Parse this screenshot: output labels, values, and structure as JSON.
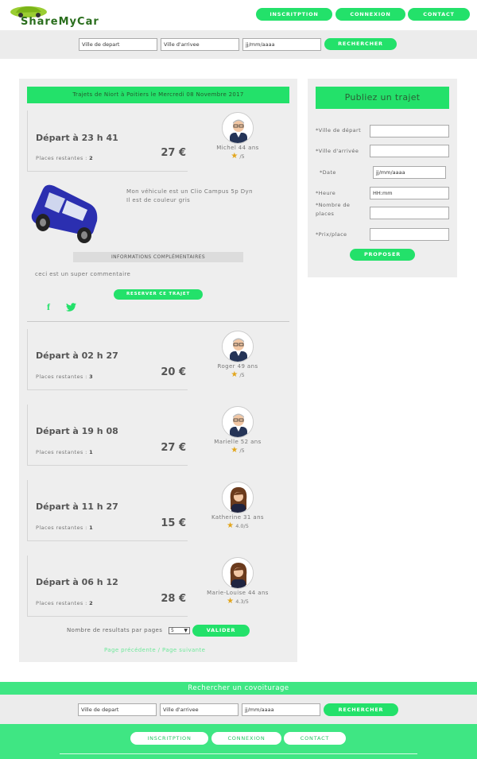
{
  "header": {
    "logo_text": "ShareMyCar",
    "nav": [
      "INSCRITPTION",
      "CONNEXION",
      "CONTACT"
    ]
  },
  "search": {
    "from_placeholder": "Ville de depart",
    "to_placeholder": "Ville d'arrivee",
    "date_placeholder": "jj/mm/aaaa",
    "button": "RECHERCHER"
  },
  "results": {
    "title": "Trajets de Niort à Poitiers le Mercredi 08 Novembre 2017",
    "places_label": "Places restantes :",
    "trips": [
      {
        "time": "Départ à 23 h 41",
        "places": "2",
        "price": "27 €",
        "driver": "Michel 44 ans",
        "rating": "/5",
        "avatar": "man"
      },
      {
        "time": "Départ à 02 h 27",
        "places": "3",
        "price": "20 €",
        "driver": "Roger 49 ans",
        "rating": "/5",
        "avatar": "man"
      },
      {
        "time": "Départ à 19 h 08",
        "places": "1",
        "price": "27 €",
        "driver": "Marielle 52 ans",
        "rating": "/5",
        "avatar": "man"
      },
      {
        "time": "Départ à 11 h 27",
        "places": "1",
        "price": "15 €",
        "driver": "Katherine 31 ans",
        "rating": "4.0/5",
        "avatar": "woman"
      },
      {
        "time": "Départ à 06 h 12",
        "places": "2",
        "price": "28 €",
        "driver": "Marie-Louise 44 ans",
        "rating": "4.3/5",
        "avatar": "woman"
      }
    ],
    "vehicle_line1": "Mon véhicule est un Clio Campus 5p Dyn",
    "vehicle_line2": "Il est de couleur gris",
    "info_header": "INFORMATIONS COMPLÉMENTAIRES",
    "comment": "ceci est un super commentaire",
    "reserve_button": "RESERVER CE TRAJET",
    "per_page_label": "Nombre de resultats par pages",
    "per_page_value": "5",
    "validate_button": "VALIDER",
    "pagination": "Page précédente / Page suivante"
  },
  "publish": {
    "title": "Publiez un trajet",
    "fields": [
      {
        "label": "*Ville de départ",
        "value": ""
      },
      {
        "label": "*Ville d'arrivée",
        "value": ""
      },
      {
        "label": "*Date",
        "value": "jj/mm/aaaa"
      },
      {
        "label": "*Heure",
        "value": "HH:mm"
      },
      {
        "label": "*Nombre de places",
        "value": ""
      },
      {
        "label": "*Prix/place",
        "value": ""
      }
    ],
    "button": "PROPOSER"
  },
  "footer_search": {
    "title": "Rechercher un covoiturage",
    "from_placeholder": "Ville de depart",
    "to_placeholder": "Ville d'arrivee",
    "date_placeholder": "jj/mm/aaaa",
    "button": "RECHERCHER"
  },
  "footer": {
    "nav": [
      "INSCRITPTION",
      "CONNEXION",
      "CONTACT"
    ]
  },
  "colors": {
    "accent": "#23e16a",
    "panel": "#eeeeee",
    "footer": "#3fe683"
  },
  "icons": [
    "car-logo-icon",
    "car-icon",
    "facebook-icon",
    "twitter-icon",
    "star-icon",
    "avatar-icon"
  ]
}
